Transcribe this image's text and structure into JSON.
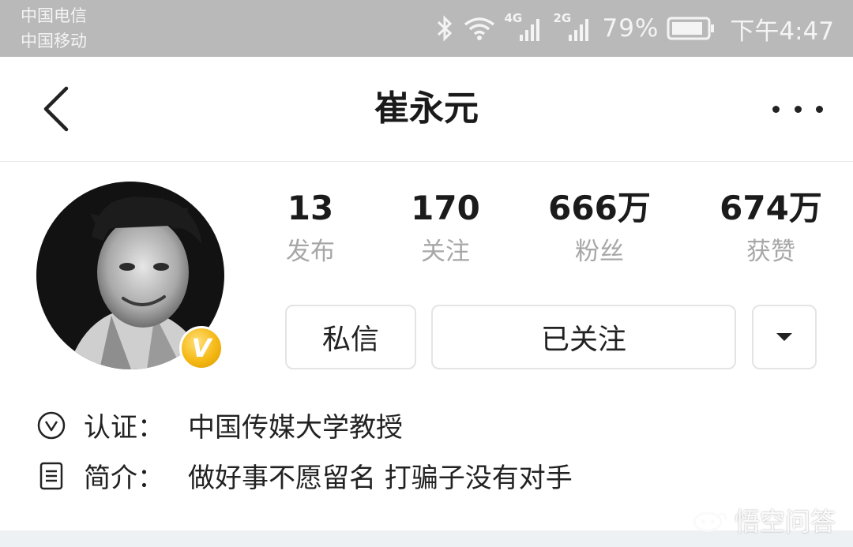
{
  "status_bar": {
    "carrier_1": "中国电信",
    "carrier_2": "中国移动",
    "net_1": "4G",
    "net_2": "2G",
    "battery": "79%",
    "time": "下午4:47"
  },
  "nav": {
    "title": "崔永元"
  },
  "profile": {
    "stats": [
      {
        "value": "13",
        "label": "发布"
      },
      {
        "value": "170",
        "label": "关注"
      },
      {
        "value": "666万",
        "label": "粉丝"
      },
      {
        "value": "674万",
        "label": "获赞"
      }
    ],
    "badge": "V",
    "buttons": {
      "message": "私信",
      "followed": "已关注"
    },
    "verification_label": "认证：",
    "verification_value": "中国传媒大学教授",
    "bio_label": "简介：",
    "bio_value": "做好事不愿留名 打骗子没有对手"
  },
  "watermark": "悟空问答",
  "colors": {
    "status_bar_bg": "#b9b9b9",
    "badge_gold": "#f5b814",
    "muted_text": "#a7a7a7"
  }
}
